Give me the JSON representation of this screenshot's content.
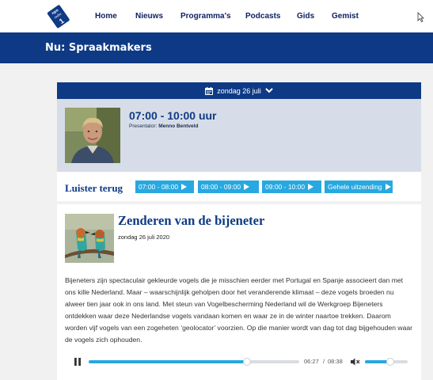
{
  "nav": {
    "logo": {
      "top_text": "npo",
      "mid_text": "radio",
      "big_text": "1"
    },
    "links": [
      "Home",
      "Nieuws",
      "Programma's",
      "Podcasts",
      "Gids",
      "Gemist"
    ]
  },
  "banner": {
    "title": "Nu: Spraakmakers"
  },
  "datebar": {
    "label": "zondag 26 juli"
  },
  "show": {
    "time": "07:00 - 10:00 uur",
    "presenter_label": "Presentator:",
    "presenter_name": "Menno Bentveld"
  },
  "listen": {
    "title": "Luister terug",
    "segments": [
      "07:00 - 08:00",
      "08:00 - 09:00",
      "09:00 - 10:00",
      "Gehele uitzending"
    ]
  },
  "article": {
    "title": "Zenderen van de bijeneter",
    "date": "zondag 26 juli 2020",
    "body": "Bijeneters zijn spectaculair gekleurde vogels die je misschien eerder met Portugal en Spanje associeert dan met ons kille Nederland. Maar – waarschijnlijk geholpen door het veranderende klimaat – deze vogels broeden nu alweer tien jaar ook in ons land. Met steun van Vogelbescherming Nederland wil de Werkgroep Bijeneters ontdekken waar deze Nederlandse vogels vandaan komen en waar ze in de winter naartoe trekken. Daarom worden vijf vogels van een zogeheten ‘geolocator’ voorzien. Op die manier wordt van dag tot dag bijgehouden waar de vogels zich ophouden."
  },
  "player": {
    "current": "06:27",
    "separator": "/",
    "total": "08:38",
    "progress_fraction": 0.75,
    "volume_fraction": 0.6
  },
  "colors": {
    "navy": "#0e3a85",
    "nav_text": "#0e1f61",
    "accent": "#27a8e0",
    "panel": "#d6dde8",
    "page_bg": "#f1f1f1"
  },
  "icons": [
    "npo-radio1-logo",
    "calendar-icon",
    "chevron-down-icon",
    "play-icon",
    "pause-icon",
    "volume-mute-icon",
    "cursor-icon"
  ]
}
